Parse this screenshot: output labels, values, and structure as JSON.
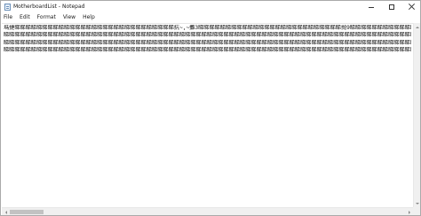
{
  "window": {
    "title": "MotherboardList - Notepad",
    "controls": {
      "minimize_icon": "minimize-icon",
      "maximize_icon": "maximize-icon",
      "close_icon": "close-icon"
    }
  },
  "menu": {
    "items": [
      {
        "label": "File"
      },
      {
        "label": "Edit"
      },
      {
        "label": "Format"
      },
      {
        "label": "View"
      },
      {
        "label": "Help"
      }
    ]
  },
  "editor": {
    "lines": [
      "瑪捷睇睇睇睇睇睇睇睇睇睇睇睇睇睇睇睇睇睇睇睇睇睇睇睇睇睇睇睇睇抗~,~攤3睇睇睇睇睇睇睇睇睇睇睇睇睇睇睇睇睇睇睇睇睇睇睇睇睇睇抛9睇睇睇睇睇睇睇睇睇睇睇睇睇睇睇睇睇睇睇睇睇睇睇睇瑪捷橄!孖鎚!滅硈!£",
      "睇睇睇睇睇睇睇睇睇睇睇睇睇睇睇睇睇睇睇睇睇睇睇睇睇睇睇睇睇睇睇睇睇睇睇睇睇睇睇睇睇睇睇睇睇睇睇睇睇睇睇睇睇睇睇睇睇睇睇睇睇睇睇睇睇睇睇睇睇睇睇睇睇睇睇睇睇睇睇睇睇睇睇",
      "睇睇睇睇睇睇睇睇睇睇睇睇睇睇睇睇睇睇睇睇睇睇睇睇睇睇睇睇睇睇睇睇睇睇睇睇睇睇睇睇睇睇睇睇睇睇睇睇睇睇睇睇睇睇睇睇睇睇睇睇睇睇睇睇睇睇睇睇睇睇睇睇睇睇睇睇睇睇睇睇睇睇睇",
      "睇睇睇睇睇睇睇睇睇睇睇睇睇睇睇睇睇睇睇睇睇睇睇睇睇睇睇睇睇睇睇睇睇睇睇睇睇睇睇睇睇睇睇睇睇睇睇睇睇睇睇睇睇睇睇睇睇睇睇睇睇睇睇睇睇睇睇睇睇睇睇睇睇睇睇睇睇睇睇睇睇睇睇"
    ]
  },
  "icons": {
    "app": "notepad-icon"
  }
}
